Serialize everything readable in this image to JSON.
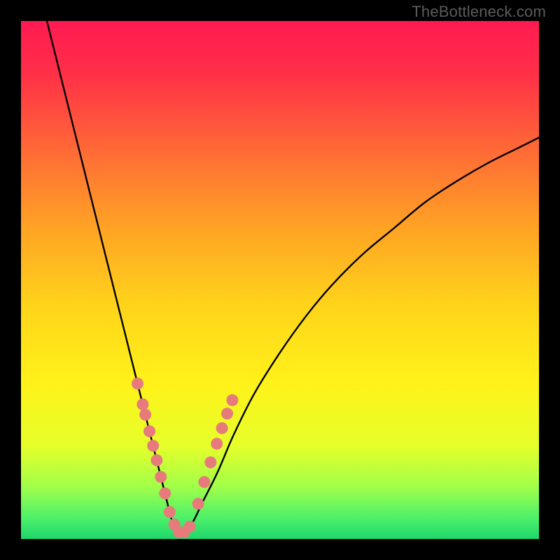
{
  "watermark": "TheBottleneck.com",
  "chart_data": {
    "type": "line",
    "title": "",
    "xlabel": "",
    "ylabel": "",
    "xlim": [
      0,
      100
    ],
    "ylim": [
      0,
      100
    ],
    "grid": false,
    "legend": false,
    "description": "Gradient background from red (top) through orange/yellow to green (bottom). Two black curves descending from upper edges to a minimum near x≈30 then rising. Salmon/red scatter markers clustered on the lower segments of both curves.",
    "series": [
      {
        "name": "left-curve",
        "x": [
          5,
          7,
          9,
          11,
          13,
          15,
          17,
          19,
          21,
          23,
          25,
          26.5,
          28,
          29,
          30,
          31
        ],
        "y": [
          100,
          92,
          84,
          76,
          68,
          60,
          52,
          44,
          36,
          28,
          20,
          14,
          8,
          4,
          1.5,
          1
        ]
      },
      {
        "name": "right-curve",
        "x": [
          31,
          33,
          35,
          38,
          41,
          45,
          50,
          55,
          60,
          66,
          72,
          78,
          84,
          90,
          96,
          100
        ],
        "y": [
          1,
          3,
          7,
          13,
          20,
          28,
          36,
          43,
          49,
          55,
          60,
          65,
          69,
          72.5,
          75.5,
          77.5
        ]
      },
      {
        "name": "scatter-markers",
        "type": "scatter",
        "color": "#e77b7b",
        "x": [
          22.5,
          23.5,
          24.0,
          24.8,
          25.5,
          26.2,
          27.0,
          27.8,
          28.7,
          29.6,
          30.5,
          31.5,
          32.6,
          34.2,
          35.4,
          36.6,
          37.8,
          38.8,
          39.8,
          40.8
        ],
        "y": [
          30.0,
          26.0,
          24.0,
          20.8,
          18.0,
          15.2,
          12.0,
          8.8,
          5.2,
          2.8,
          1.3,
          1.3,
          2.4,
          6.8,
          11.0,
          14.8,
          18.4,
          21.4,
          24.2,
          26.8
        ]
      }
    ],
    "gradient_stops": [
      {
        "offset": 0.0,
        "color": "#ff1a52"
      },
      {
        "offset": 0.1,
        "color": "#ff2f48"
      },
      {
        "offset": 0.25,
        "color": "#ff6a36"
      },
      {
        "offset": 0.4,
        "color": "#ffa324"
      },
      {
        "offset": 0.55,
        "color": "#ffd41a"
      },
      {
        "offset": 0.7,
        "color": "#fff21a"
      },
      {
        "offset": 0.82,
        "color": "#e6ff2a"
      },
      {
        "offset": 0.9,
        "color": "#a0ff4a"
      },
      {
        "offset": 0.96,
        "color": "#4cf06a"
      },
      {
        "offset": 1.0,
        "color": "#1fd66b"
      }
    ]
  }
}
